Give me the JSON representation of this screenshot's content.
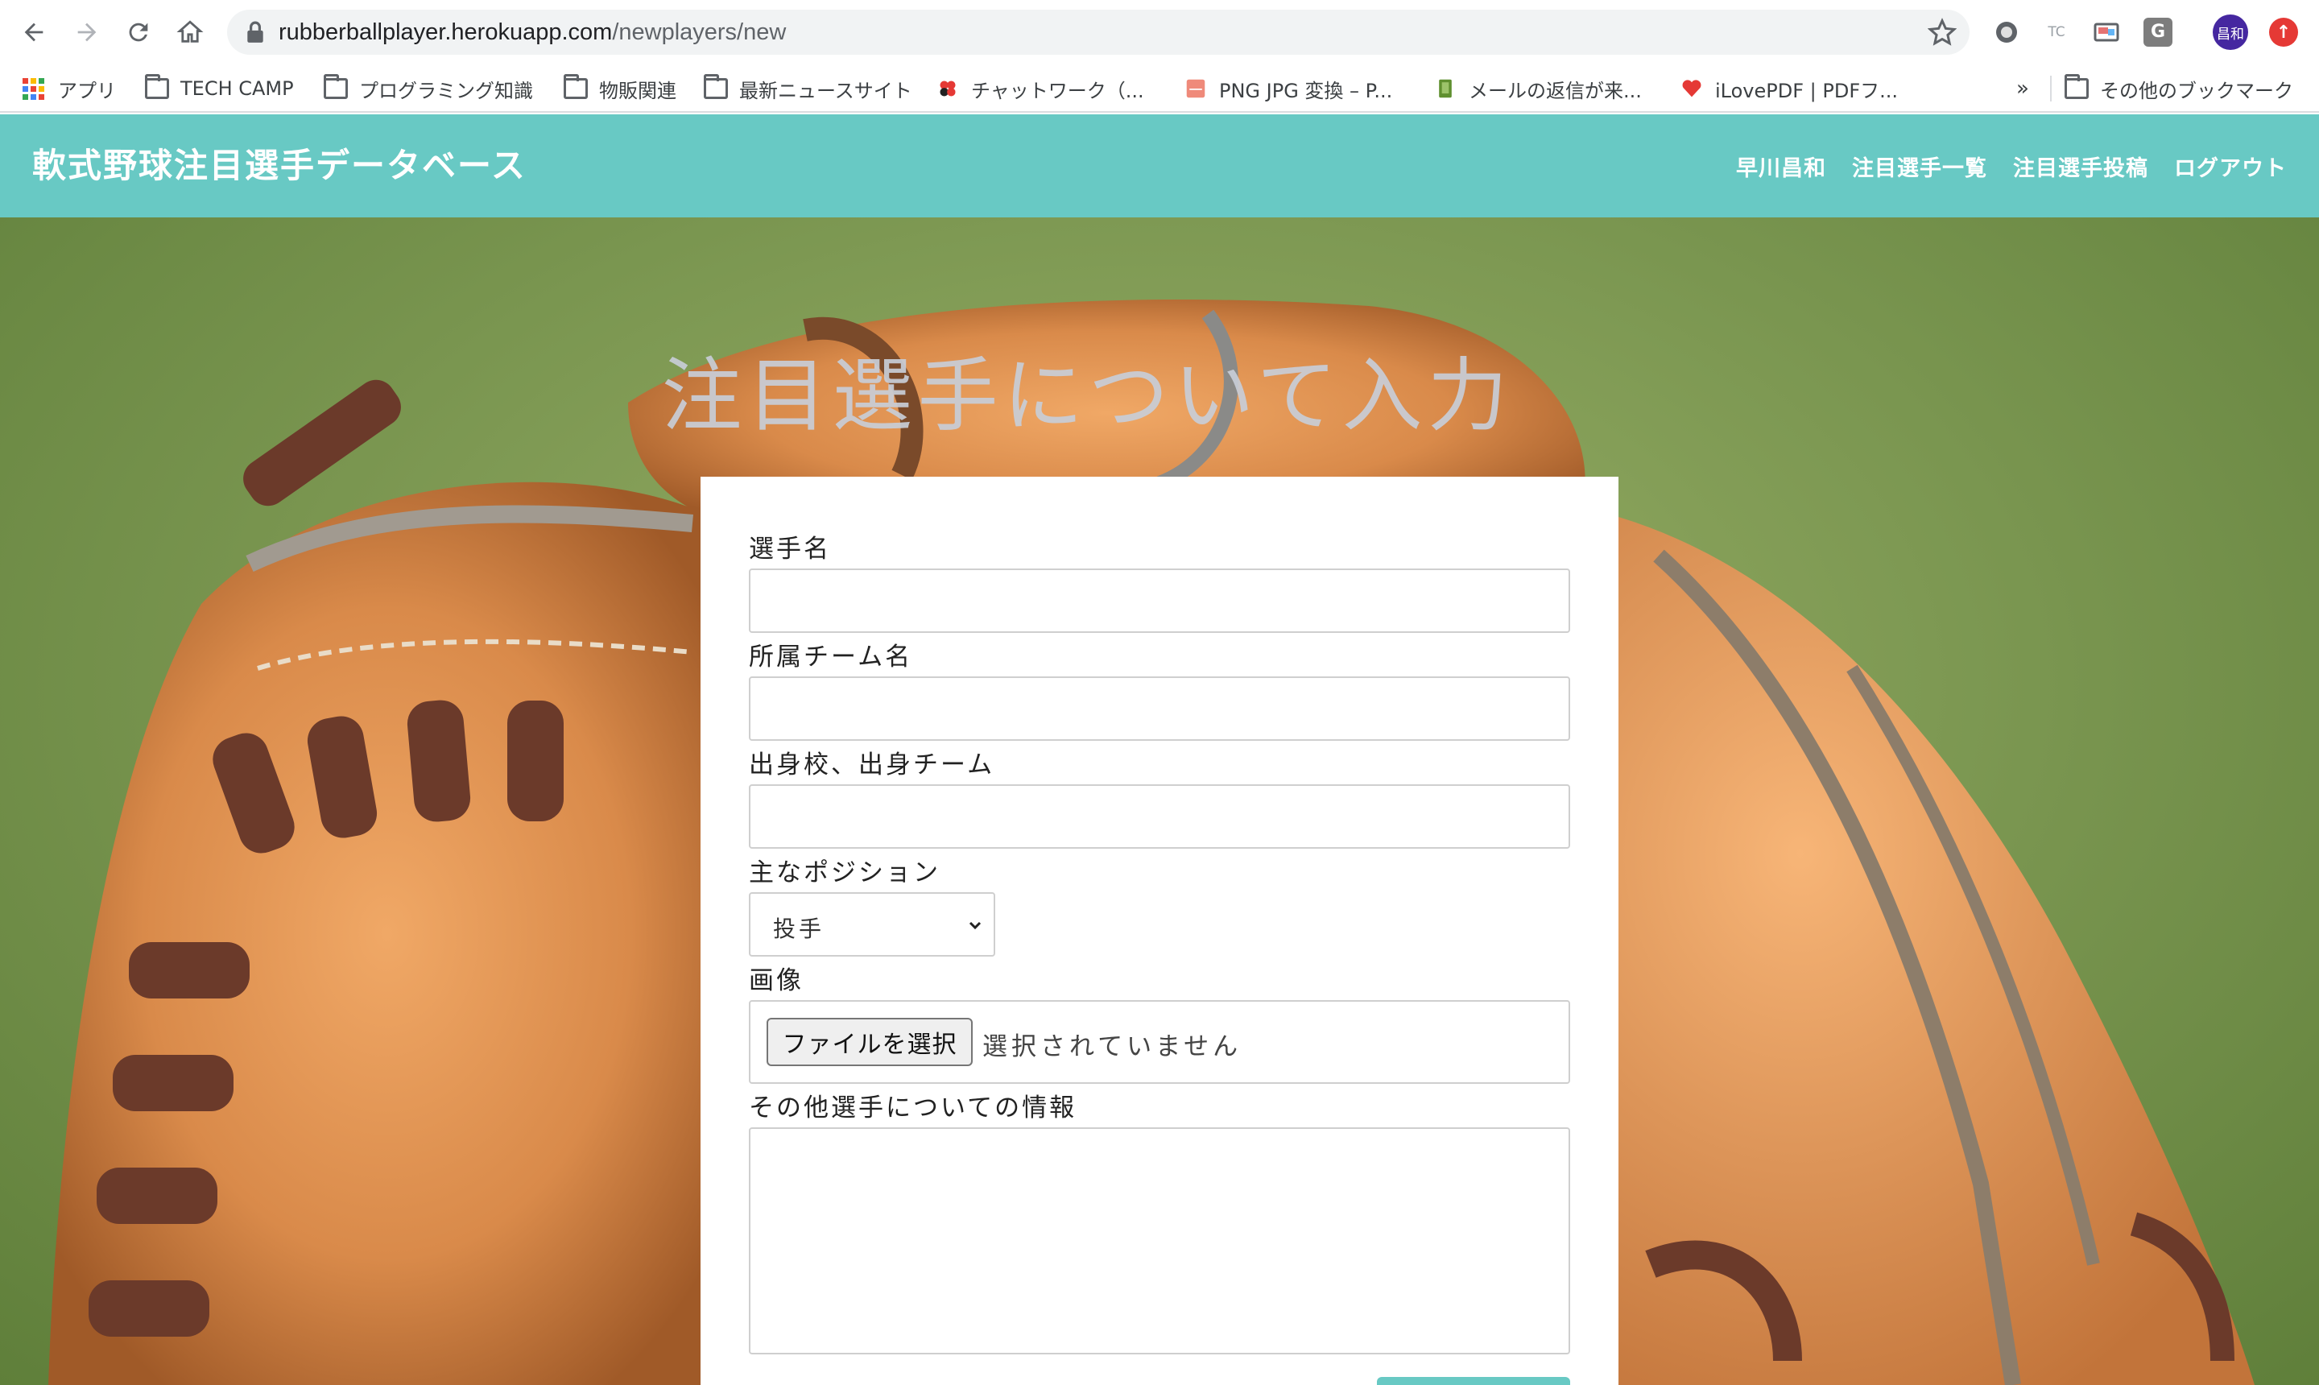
{
  "browser": {
    "url_host": "rubberballplayer.herokuapp.com",
    "url_path": "/newplayers/new",
    "profile_initials": "昌和",
    "ext_tc_label": "TC",
    "ext_g_label": "G",
    "bookmarks": [
      {
        "label": "アプリ",
        "icon": "apps-icon"
      },
      {
        "label": "TECH CAMP",
        "icon": "folder-icon"
      },
      {
        "label": "プログラミング知識",
        "icon": "folder-icon"
      },
      {
        "label": "物販関連",
        "icon": "folder-icon"
      },
      {
        "label": "最新ニュースサイト",
        "icon": "folder-icon"
      },
      {
        "label": "チャットワーク（...",
        "icon": "chatwork-icon"
      },
      {
        "label": "PNG JPG 変換 – P...",
        "icon": "png-jpg-icon"
      },
      {
        "label": "メールの返信が来...",
        "icon": "evernote-icon"
      },
      {
        "label": "iLovePDF | PDFフ...",
        "icon": "ilovepdf-icon"
      }
    ],
    "more_label": "»",
    "other_bookmarks": "その他のブックマーク"
  },
  "site": {
    "brand": "軟式野球注目選手データベース",
    "nav": [
      "早川昌和",
      "注目選手一覧",
      "注目選手投稿",
      "ログアウト"
    ],
    "accent_color": "#68c9c4"
  },
  "form": {
    "title": "注目選手について入力",
    "player_name_label": "選手名",
    "team_label": "所属チーム名",
    "origin_label": "出身校、出身チーム",
    "position_label": "主なポジション",
    "position_selected": "投手",
    "image_label": "画像",
    "file_button": "ファイルを選択",
    "file_status": "選択されていません",
    "info_label": "その他選手についての情報"
  }
}
